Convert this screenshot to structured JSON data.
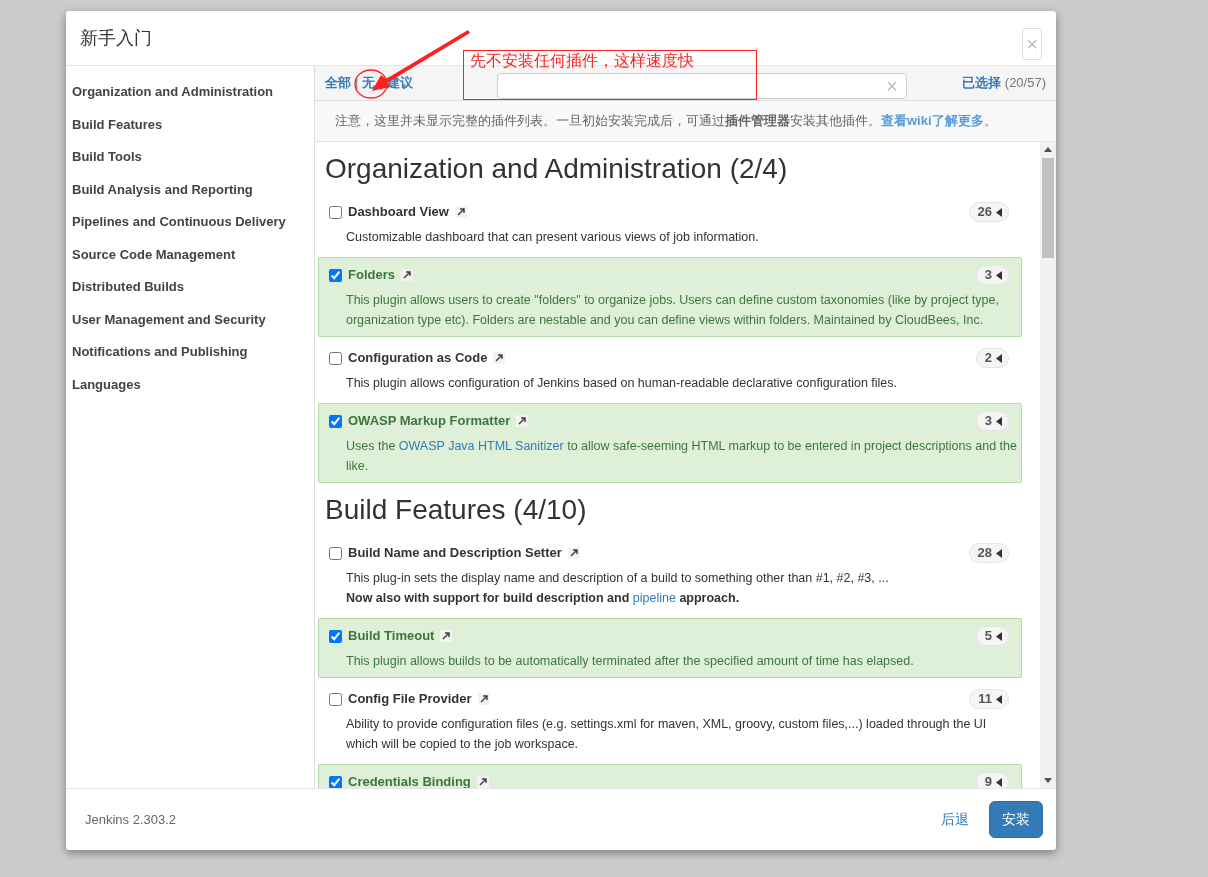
{
  "dialog": {
    "title": "新手入门",
    "close": "×"
  },
  "sidebar": {
    "items": [
      {
        "label": "Organization and Administration"
      },
      {
        "label": "Build Features"
      },
      {
        "label": "Build Tools"
      },
      {
        "label": "Build Analysis and Reporting"
      },
      {
        "label": "Pipelines and Continuous Delivery"
      },
      {
        "label": "Source Code Management"
      },
      {
        "label": "Distributed Builds"
      },
      {
        "label": "User Management and Security"
      },
      {
        "label": "Notifications and Publishing"
      },
      {
        "label": "Languages"
      }
    ]
  },
  "toolbar": {
    "filters": [
      {
        "label": "全部"
      },
      {
        "label": "无"
      },
      {
        "label": "建议"
      }
    ],
    "separator": "|",
    "search_clear": "×",
    "selected_label": "已选择",
    "selected_count": "(20/57)"
  },
  "notice": [
    {
      "text": "注意，这里并未显示完整的插件列表。一旦初始安装完成后，可通过"
    },
    {
      "text": "插件管理器",
      "bold": true
    },
    {
      "text": "安装其他插件。"
    },
    {
      "text": "查看wiki了解更多",
      "link": true
    },
    {
      "text": "。"
    }
  ],
  "sections": [
    {
      "title": "Organization and Administration (2/4)",
      "plugins": [
        {
          "name": "Dashboard View",
          "checked": false,
          "count": "26",
          "description": [
            [
              {
                "text": "Customizable dashboard that can present various views of job information."
              }
            ]
          ]
        },
        {
          "name": "Folders",
          "checked": true,
          "count": "3",
          "description": [
            [
              {
                "text": "This plugin allows users to create \"folders\" to organize jobs. Users can define custom taxonomies (like by project type, organization type etc). Folders are nestable and you can define views within folders. Maintained by CloudBees, Inc."
              }
            ]
          ]
        },
        {
          "name": "Configuration as Code",
          "checked": false,
          "count": "2",
          "description": [
            [
              {
                "text": "This plugin allows configuration of Jenkins based on human-readable declarative configuration files."
              }
            ]
          ]
        },
        {
          "name": "OWASP Markup Formatter",
          "checked": true,
          "count": "3",
          "description": [
            [
              {
                "text": "Uses the "
              },
              {
                "text": "OWASP Java HTML Sanitizer",
                "link": true
              },
              {
                "text": " to allow safe-seeming HTML markup to be entered in project descriptions and the like."
              }
            ]
          ]
        }
      ]
    },
    {
      "title": "Build Features (4/10)",
      "plugins": [
        {
          "name": "Build Name and Description Setter",
          "checked": false,
          "count": "28",
          "description": [
            [
              {
                "text": "This plug-in sets the display name and description of a build to something other than #1, #2, #3, ..."
              }
            ],
            [
              {
                "text": "Now also with support for build description and ",
                "bold": true
              },
              {
                "text": "pipeline",
                "link": true
              },
              {
                "text": " approach.",
                "bold": true
              }
            ]
          ]
        },
        {
          "name": "Build Timeout",
          "checked": true,
          "count": "5",
          "description": [
            [
              {
                "text": "This plugin allows builds to be automatically terminated after the specified amount of time has elapsed."
              }
            ]
          ]
        },
        {
          "name": "Config File Provider",
          "checked": false,
          "count": "11",
          "description": [
            [
              {
                "text": "Ability to provide configuration files (e.g. settings.xml for maven, XML, groovy, custom files,...) loaded through the UI which will be copied to the job workspace."
              }
            ]
          ]
        },
        {
          "name": "Credentials Binding",
          "checked": true,
          "count": "9"
        }
      ]
    }
  ],
  "footer": {
    "version": "Jenkins 2.303.2",
    "back": "后退",
    "install": "安装"
  },
  "annotation": {
    "text": "先不安装任何插件，这样速度快"
  }
}
